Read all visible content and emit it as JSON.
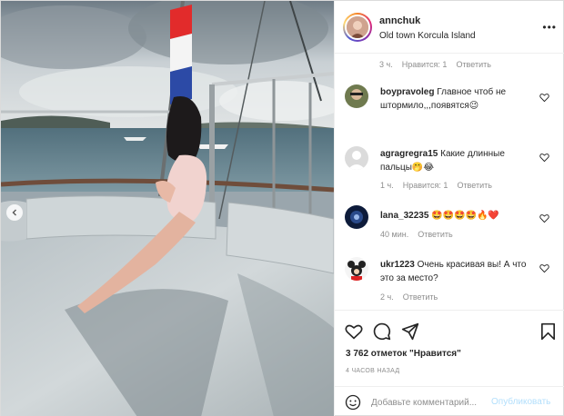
{
  "header": {
    "username": "annchuk",
    "location": "Old town Korcula Island",
    "more_icon": "more-horizontal-icon"
  },
  "top_meta": {
    "time": "3 ч.",
    "likes": "Нравится: 1",
    "reply": "Ответить"
  },
  "comments": [
    {
      "user": "boypravoleg",
      "text": "Главное чтоб не штормило,,,появятся😉",
      "time": "",
      "likes": "",
      "reply": ""
    },
    {
      "user": "agragregra15",
      "text": "Какие длинные пальцы🤭😂",
      "time": "1 ч.",
      "likes": "Нравится: 1",
      "reply": "Ответить"
    },
    {
      "user": "lana_32235",
      "text": "🤩🤩🤩🤩🔥❤️",
      "time": "40 мин.",
      "likes": "",
      "reply": "Ответить"
    },
    {
      "user": "ukr1223",
      "text": "Очень красивая вы! А что это за место?",
      "time": "2 ч.",
      "likes": "",
      "reply": "Ответить"
    }
  ],
  "actions": {
    "likes_count": "3 762 отметок \"Нравится\"",
    "posted": "4 ЧАСОВ НАЗАД",
    "icons": [
      "heart-icon",
      "comment-icon",
      "share-icon",
      "bookmark-icon"
    ]
  },
  "add_comment": {
    "placeholder": "Добавьте комментарий...",
    "publish": "Опубликовать"
  },
  "colors": {
    "link_disabled": "#b2dffc",
    "muted": "#8e8e8e",
    "border": "#efefef"
  }
}
